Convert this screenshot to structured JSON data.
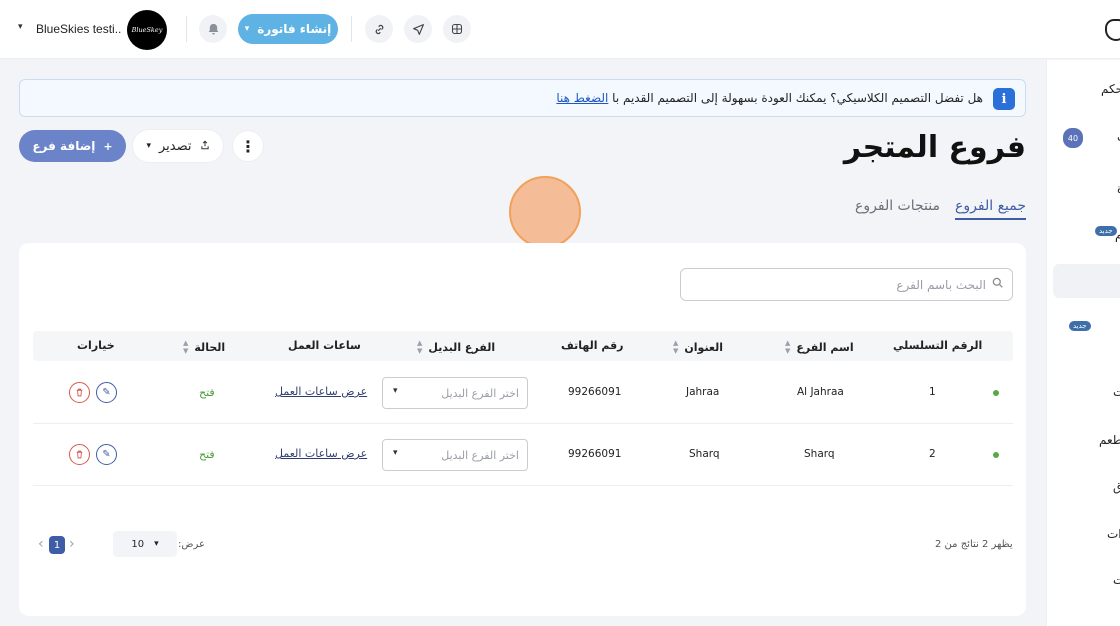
{
  "topbar": {
    "store_name": "BlueSkies testi..",
    "logo_text": "BlueSkey",
    "invoice_label": "إنشاء فاتورة",
    "icons": [
      "bell-icon",
      "link-icon",
      "send-icon",
      "grid-icon"
    ]
  },
  "banner": {
    "text": "هل تفضل التصميم الكلاسيكي؟ يمكنك العودة بسهولة إلى التصميم القديم با",
    "link": "الضغط هنا"
  },
  "page": {
    "title": "فروع المتجر",
    "add_label": "إضافة فرع",
    "export_label": "تصدير"
  },
  "tabs": [
    {
      "label": "جميع الفروع",
      "active": true
    },
    {
      "label": "منتجات الفروع",
      "active": false
    }
  ],
  "search": {
    "placeholder": "البحث باسم الفرع",
    "value": ""
  },
  "table": {
    "headers": {
      "serial": "الرقم التسلسلي",
      "name": "اسم الفرع",
      "address": "العنوان",
      "phone": "رقم الهاتف",
      "alt": "الفرع البديل",
      "hours": "ساعات العمل",
      "status": "الحالة",
      "options": "خيارات"
    },
    "rows": [
      {
        "serial": "1",
        "name": "Al Jahraa",
        "address": "Jahraa",
        "phone": "99266091",
        "alt_placeholder": "اختر الفرع البديل",
        "hours_link": "عرض ساعات العمل",
        "status": "فتح"
      },
      {
        "serial": "2",
        "name": "Sharq",
        "address": "Sharq",
        "phone": "99266091",
        "alt_placeholder": "اختر الفرع البديل",
        "hours_link": "عرض ساعات العمل",
        "status": "فتح"
      }
    ]
  },
  "footer": {
    "results_text": "يظهر 2 نتائج من 2",
    "show_label": "عرض:",
    "per_page": "10",
    "current_page": "1"
  },
  "sidebar": {
    "labels": [
      "حكم",
      "ب",
      "ة",
      "م",
      "ت",
      "طعم",
      "ق",
      "ات",
      "ت"
    ],
    "badge_count": "40",
    "new_label": "جديد"
  },
  "colors": {
    "primary": "#6b83c8",
    "accent": "#3f5da6",
    "invoice": "#5eb3e4",
    "status_open": "#4a9a3b",
    "danger": "#d45a4e"
  }
}
